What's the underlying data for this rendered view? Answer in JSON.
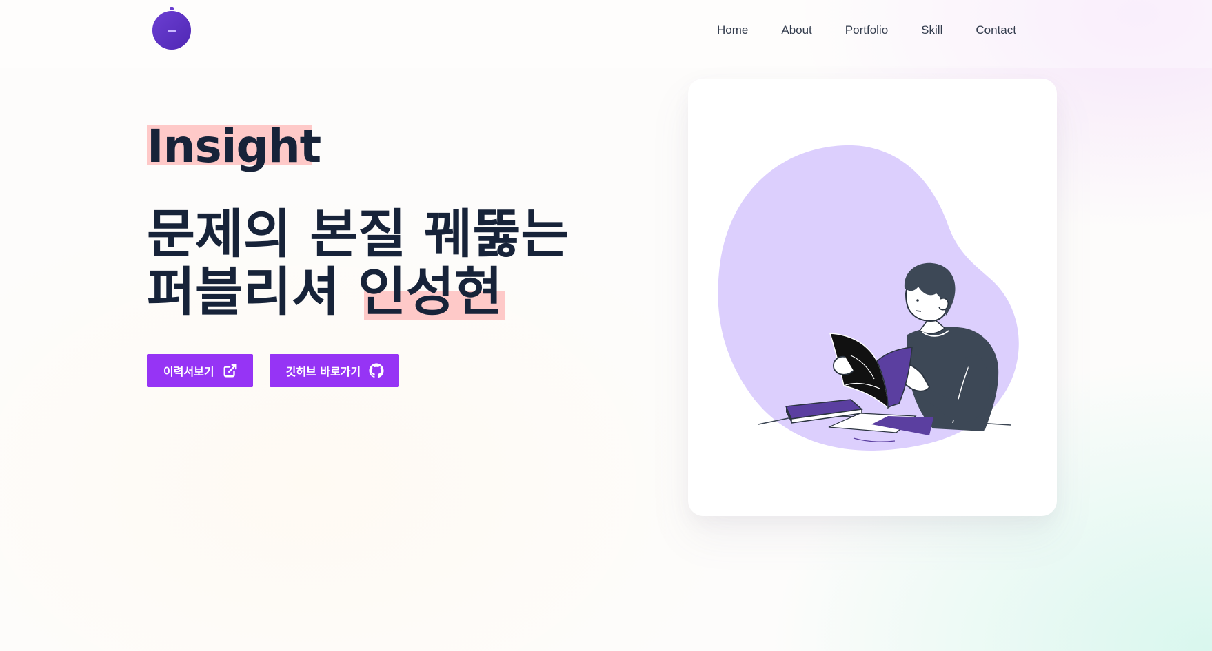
{
  "header": {
    "logo_icon": "stopwatch-logo-icon",
    "nav": [
      {
        "label": "Home"
      },
      {
        "label": "About"
      },
      {
        "label": "Portfolio"
      },
      {
        "label": "Skill"
      },
      {
        "label": "Contact"
      }
    ]
  },
  "hero": {
    "eyebrow": "Insight",
    "headline_line1": "문제의 본질 꿰뚫는",
    "headline_line2_prefix": "퍼블리셔 ",
    "headline_line2_name": "인성현",
    "buttons": [
      {
        "label": "이력서보기",
        "icon": "external-link-icon"
      },
      {
        "label": "깃허브 바로가기",
        "icon": "github-icon"
      }
    ]
  },
  "illustration": {
    "subject": "man-reading-book-illustration"
  },
  "colors": {
    "accent": "#9634f5",
    "highlight": "#fec9c8",
    "blob": "#dccffd",
    "logo": "#5b2fc2",
    "text": "#172339"
  }
}
